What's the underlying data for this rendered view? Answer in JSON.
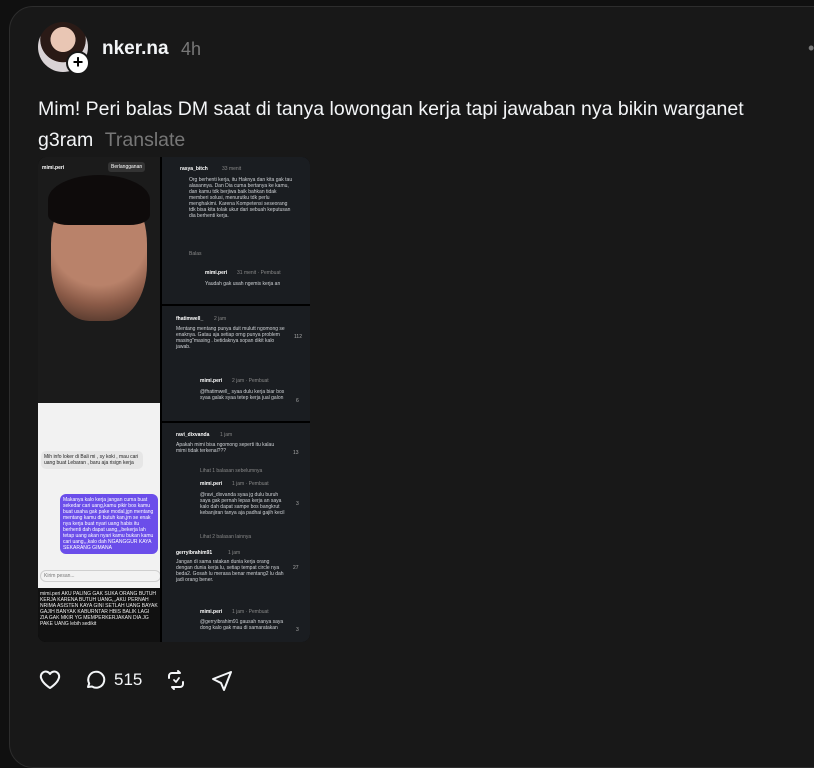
{
  "post": {
    "username": "nker.na",
    "time": "4h",
    "caption": "Mim! Peri balas DM saat di tanya lowongan kerja tapi jawaban nya bikin warganet g3ram",
    "translate_label": "Translate"
  },
  "media": {
    "profile_handle": "mimi.peri",
    "subscribe_label": "Berlangganan",
    "dm_question": "Mih info loker di Bali mi , sy koki , mau cari uang buat Lebaran , baru aja risign kerja",
    "dm_reply": "Makanya kalo kerja jangan cuma buat sekedar cari uang,kamu pikir bos kamu buat usaha gak pake modal,jgn mentang mentang kamu di butuh kan,jrn se enak nya kerja buat nyari uang habis itu berhenti dah dapat uang,,,bekerja lah tetap uang akan nyari kamu bukan kamu cari uang,,,kalo dah NGANGGUR KAYA SEKARANG GIMANA",
    "dm_input": "Kirim pesan...",
    "bottom_text": "mimi.peri AKU PALING GAK SUKA ORANG BUTUH KERJA KARENA BUTUH UANG,,,AKU PERNAH NRIMA ASISTEN KAYA GINI SETLAH UANG BAYAK GAJIH BANYAK KABURNTAR HBIS BALIK LAGI ZIA GAK MKIR YG MEMPERKERJAKAN DIA JG PAKE UANG lebih sedikit",
    "comments": [
      {
        "user": "rasya_bitch",
        "time": "33 menit",
        "text": "Org berhenti kerja, itu Haknya dan kita gak tau alasannya. Dan Dia cuma bertanya ke kamu, dan kamu tdk berjiwa baik bahkan tidak memberi solusi, menurutku tdk perlu menghakimi. Karena Kompetensi seseorang tdk bisa kita tolak ukur dari sebuah keputusan dia berhenti kerja.",
        "reply_label": "Balas"
      },
      {
        "user": "mimi.peri",
        "time": "31 menit · Pembuat",
        "text": "Yaudah gak usah ngemis kerja an"
      },
      {
        "user": "fhatimwell_",
        "time": "2 jam",
        "text": "Mentang mentang punya duit mulutt ngomong se enaknya. Gatau aja setiap orng punya problem masing\"masing . betidaknya sopan dikit kalo jawab.",
        "likes": "112"
      },
      {
        "user": "mimi.peri",
        "time": "2 jam · Pembuat",
        "text": "@fhatimwell_ syaa dulu kerja biar bos syaa galak syaa tetep kerja jual galon",
        "likes": "6"
      },
      {
        "user": "ravi_dixvanda",
        "time": "1 jam",
        "text": "Apakah mimi bisa ngomong seperti itu kalau mimi tidak terkenal???",
        "likes": "13",
        "more": "Lihat 1 balasan sebelumnya"
      },
      {
        "user": "mimi.peri",
        "time": "1 jam · Pembuat",
        "text": "@ravi_dixvanda syaa jg dulu buruh saya gak pernah lepas kerja an saya kalo dah dapat sampe bos bangkrut kebanjiran tanya aja padhai gajih kecil",
        "likes": "3",
        "more": "Lihat 2 balasan lainnya"
      },
      {
        "user": "gerryibrahim91",
        "time": "1 jam",
        "text": "Jangan di sama ratakan dunia kerja orang dengan dunia kerja lu, setiap tempat circle nya beda2. Gosah lu merasa benar mentang2 lu dah jadi orang bener.",
        "likes": "27"
      },
      {
        "user": "mimi.peri",
        "time": "1 jam · Pembuat",
        "text": "@gerryibrahim91 gausah nanya saya dong kalo gak mau di samaratakan",
        "likes": "3"
      }
    ]
  },
  "actions": {
    "reply_count": "515"
  },
  "colors": {
    "background": "#101010",
    "card": "#181818",
    "text": "#f3f5f7",
    "muted": "#777777"
  }
}
